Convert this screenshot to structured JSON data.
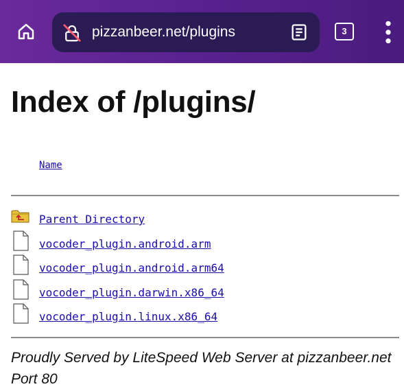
{
  "browser": {
    "url": "pizzanbeer.net/plugins",
    "tab_count": "3",
    "icons": {
      "home": "home-icon",
      "site_info": "not-secure-lock-icon",
      "reader": "reader-mode-icon",
      "tabs": "tab-switcher-icon",
      "menu": "more-vert-icon"
    },
    "colors": {
      "toolbar": "#5a2290",
      "url_pill": "#2a1b55"
    }
  },
  "page": {
    "title": "Index of /plugins/",
    "column_header": "Name",
    "entries": [
      {
        "name": "Parent Directory",
        "icon": "parent-folder-icon"
      },
      {
        "name": "vocoder_plugin.android.arm",
        "icon": "file-icon"
      },
      {
        "name": "vocoder_plugin.android.arm64",
        "icon": "file-icon"
      },
      {
        "name": "vocoder_plugin.darwin.x86_64",
        "icon": "file-icon"
      },
      {
        "name": "vocoder_plugin.linux.x86_64",
        "icon": "file-icon"
      }
    ],
    "footer": "Proudly Served by LiteSpeed Web Server at pizzanbeer.net Port 80",
    "link_color": "#1a0dab"
  }
}
